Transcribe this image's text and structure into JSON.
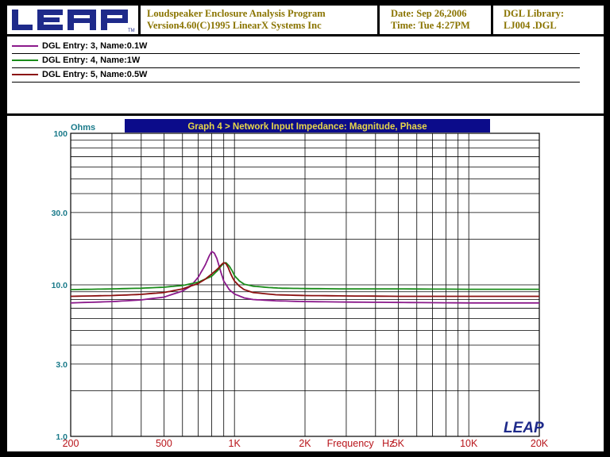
{
  "header": {
    "program_line1": "Loudspeaker Enclosure Analysis Program",
    "program_line2": "Version4.60(C)1995 LinearX Systems Inc",
    "date_line": "Date: Sep 26,2006",
    "time_line": "Time: Tue  4:27PM",
    "library_label": "DGL Library:",
    "library_file": "LJ004   .DGL",
    "logo_text": "LEAP",
    "logo_tm": "TM"
  },
  "legend": [
    {
      "label": "DGL Entry: 3, Name:0.1W",
      "color": "#8b1a8b"
    },
    {
      "label": "DGL Entry: 4, Name:1W",
      "color": "#1a8c1a"
    },
    {
      "label": "DGL Entry: 5, Name:0.5W",
      "color": "#8b1010"
    }
  ],
  "watermark": "LEAP",
  "chart_data": {
    "type": "line",
    "title": "Graph 4 > Network Input Impedance: Magnitude, Phase",
    "xlabel": "Frequency   Hz",
    "ylabel": "Ohms",
    "x_scale": "log",
    "y_scale": "log",
    "xlim": [
      200,
      20000
    ],
    "ylim": [
      1,
      100
    ],
    "grid": true,
    "x_ticks": [
      {
        "value": 200,
        "label": "200"
      },
      {
        "value": 500,
        "label": "500"
      },
      {
        "value": 1000,
        "label": "1K"
      },
      {
        "value": 2000,
        "label": "2K"
      },
      {
        "value": 5000,
        "label": "5K"
      },
      {
        "value": 10000,
        "label": "10K"
      },
      {
        "value": 20000,
        "label": "20K"
      }
    ],
    "y_ticks": [
      {
        "value": 100,
        "label": "100"
      },
      {
        "value": 30,
        "label": "30.0"
      },
      {
        "value": 10,
        "label": "10.0"
      },
      {
        "value": 3,
        "label": "3.0"
      },
      {
        "value": 1,
        "label": "1.0"
      }
    ],
    "series": [
      {
        "name": "DGL Entry: 3, Name:0.1W",
        "color": "#8b1a8b",
        "x": [
          200,
          300,
          400,
          500,
          600,
          650,
          700,
          750,
          780,
          800,
          820,
          840,
          860,
          880,
          900,
          950,
          1000,
          1100,
          1200,
          1500,
          2000,
          3000,
          5000,
          10000,
          20000
        ],
        "y": [
          7.6,
          7.75,
          7.95,
          8.3,
          9.1,
          9.8,
          11.2,
          13.5,
          15.5,
          16.6,
          16.2,
          15.0,
          13.3,
          11.8,
          10.6,
          9.3,
          8.7,
          8.2,
          8.0,
          7.85,
          7.75,
          7.7,
          7.65,
          7.6,
          7.6
        ]
      },
      {
        "name": "DGL Entry: 4, Name:1W",
        "color": "#1a8c1a",
        "x": [
          200,
          300,
          400,
          500,
          600,
          700,
          800,
          850,
          880,
          900,
          920,
          950,
          980,
          1000,
          1050,
          1100,
          1200,
          1400,
          1600,
          2000,
          3000,
          5000,
          10000,
          20000
        ],
        "y": [
          9.3,
          9.4,
          9.5,
          9.65,
          9.9,
          10.4,
          11.4,
          12.5,
          13.4,
          13.9,
          14.0,
          13.3,
          12.3,
          11.5,
          10.6,
          10.1,
          9.8,
          9.6,
          9.5,
          9.45,
          9.4,
          9.4,
          9.35,
          9.35
        ]
      },
      {
        "name": "DGL Entry: 5, Name:0.5W",
        "color": "#8b1010",
        "x": [
          200,
          300,
          400,
          500,
          600,
          700,
          750,
          800,
          850,
          880,
          900,
          920,
          940,
          960,
          980,
          1000,
          1050,
          1100,
          1200,
          1500,
          2000,
          3000,
          5000,
          10000,
          20000
        ],
        "y": [
          8.4,
          8.5,
          8.65,
          8.9,
          9.4,
          10.2,
          10.9,
          11.8,
          12.8,
          13.6,
          14.0,
          13.8,
          13.0,
          12.0,
          11.2,
          10.6,
          9.8,
          9.3,
          8.9,
          8.6,
          8.5,
          8.45,
          8.4,
          8.4,
          8.4
        ]
      }
    ]
  }
}
